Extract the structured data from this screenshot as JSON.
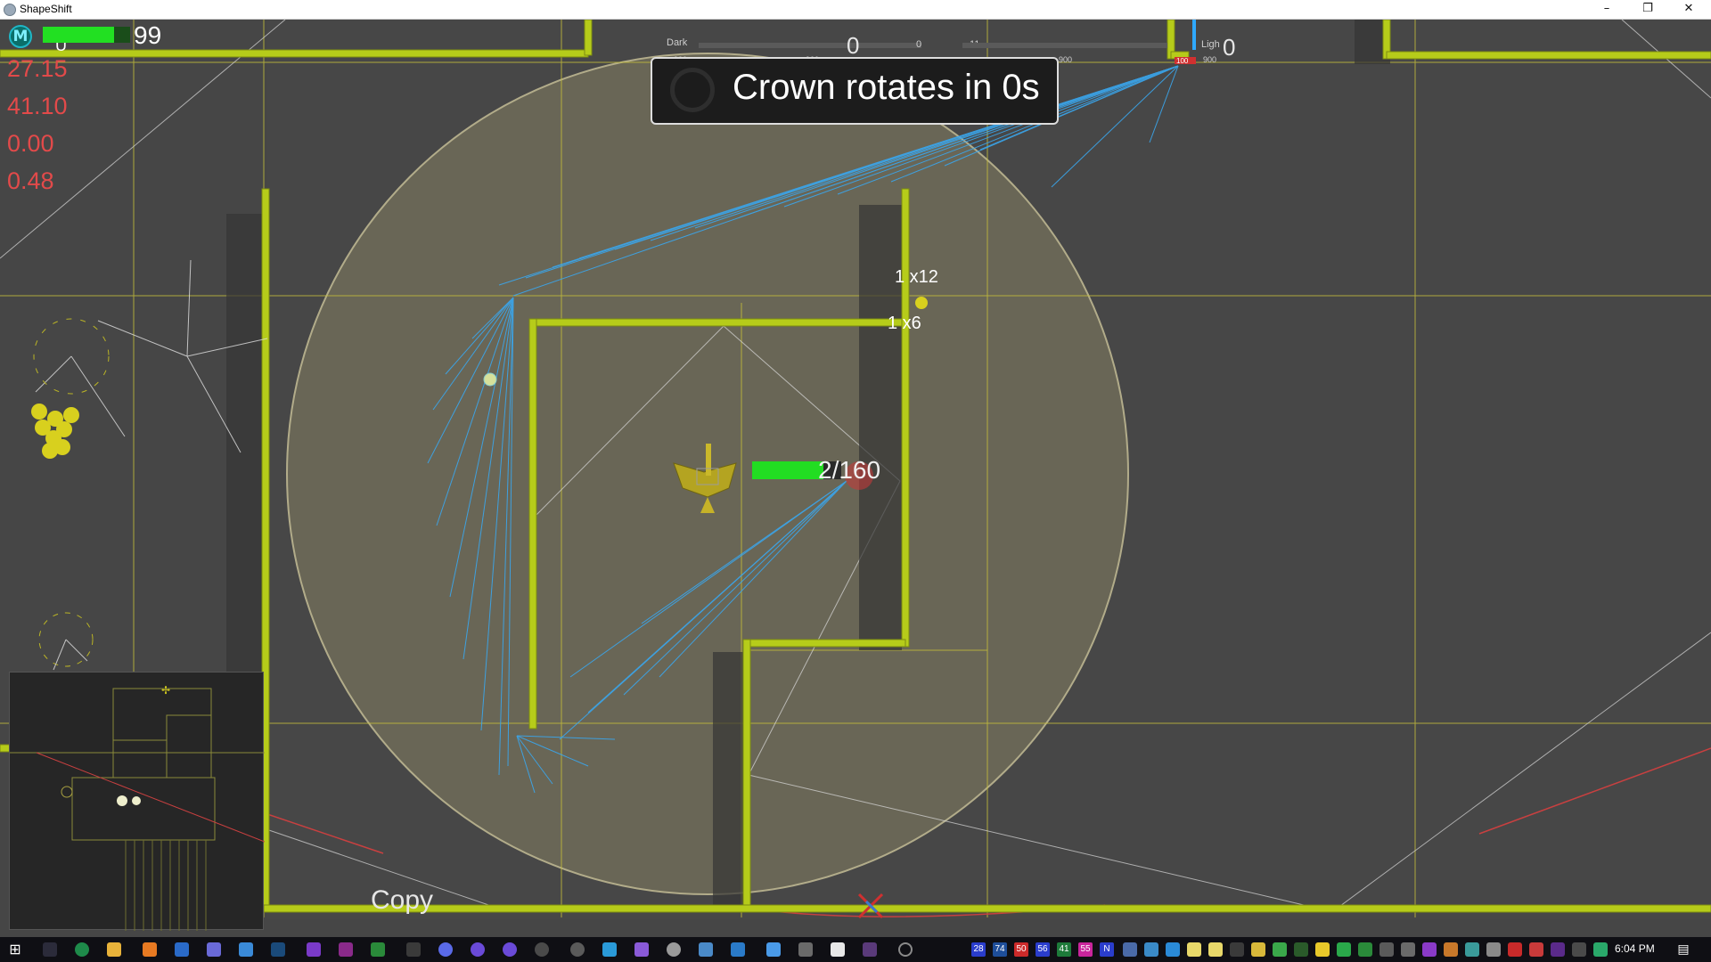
{
  "window": {
    "title": "ShapeShift",
    "controls": [
      "–",
      "❐",
      "✕"
    ]
  },
  "hud": {
    "hp_value": "99",
    "hp_fraction": 0.82,
    "avatar_letter": "M",
    "avatar_sub": "U",
    "stats": [
      "27.15",
      "41.10",
      "0.00",
      "0.48"
    ],
    "crown_message": "Crown rotates in 0s",
    "team_dark_label": "Dark",
    "team_light_label": "Ligh",
    "dark_score": "0",
    "light_score": "0",
    "center_small_scores": [
      "0",
      "11"
    ],
    "bar_ticks": [
      "900",
      "900",
      "900",
      "900"
    ],
    "light_marker": "100"
  },
  "world": {
    "multipliers": [
      "1 x12",
      "1 x6"
    ],
    "copy_label": "Copy",
    "unit_hp_text": "2/160",
    "unit_hp_fraction": 0.8
  },
  "colors": {
    "wall": "#b6cc1a",
    "grid": "#c9c23a",
    "ray": "#3aa7ee",
    "range_circle": "#8b8566",
    "stat_text": "#e24a4a",
    "health": "#22e022"
  },
  "taskbar": {
    "clock": "6:04 PM",
    "tray_badges": [
      "28",
      "74",
      "50",
      "56",
      "41",
      "55",
      "N"
    ],
    "tray_badge_colors": [
      "#2a3dcc",
      "#1e4e9a",
      "#cc2a2a",
      "#2a3dcc",
      "#1d7a3a",
      "#c9259c",
      "#2a3dcc"
    ]
  }
}
